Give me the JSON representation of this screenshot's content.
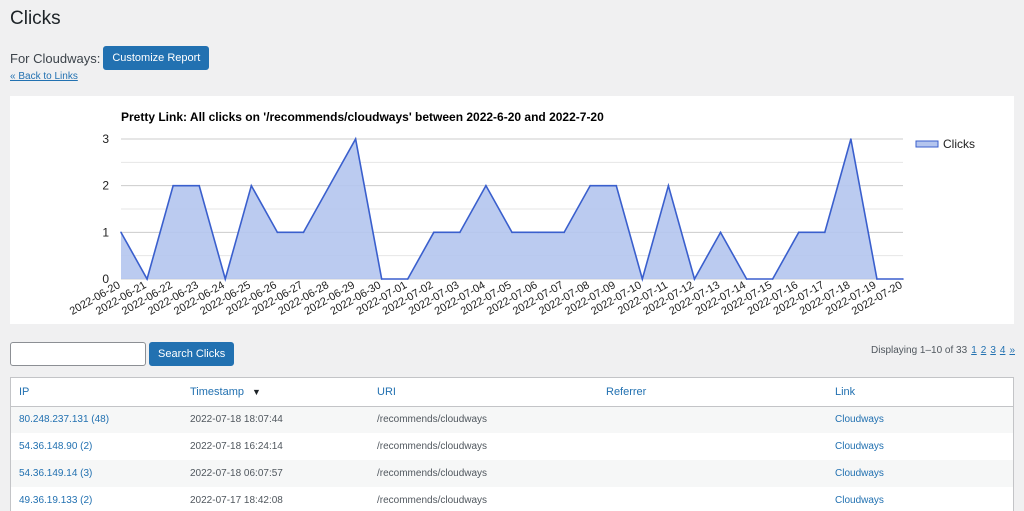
{
  "page": {
    "title": "Clicks"
  },
  "report": {
    "for_label": "For Cloudways:",
    "customize_label": "Customize Report",
    "back_label": "« Back to Links"
  },
  "search": {
    "value": "",
    "placeholder": "",
    "button_label": "Search Clicks"
  },
  "pagination": {
    "displaying": "Displaying 1–10 of 33",
    "pages": [
      "1",
      "2",
      "3",
      "4"
    ],
    "next": "»"
  },
  "table": {
    "columns": [
      "IP",
      "Timestamp",
      "URI",
      "Referrer",
      "Link"
    ],
    "sort_icon": "sort-desc-icon",
    "rows": [
      {
        "ip": "80.248.237.131 (48)",
        "timestamp": "2022-07-18 18:07:44",
        "uri": "/recommends/cloudways",
        "referrer": "",
        "link": "Cloudways"
      },
      {
        "ip": "54.36.148.90 (2)",
        "timestamp": "2022-07-18 16:24:14",
        "uri": "/recommends/cloudways",
        "referrer": "",
        "link": "Cloudways"
      },
      {
        "ip": "54.36.149.14 (3)",
        "timestamp": "2022-07-18 06:07:57",
        "uri": "/recommends/cloudways",
        "referrer": "",
        "link": "Cloudways"
      },
      {
        "ip": "49.36.19.133 (2)",
        "timestamp": "2022-07-17 18:42:08",
        "uri": "/recommends/cloudways",
        "referrer": "",
        "link": "Cloudways"
      }
    ]
  },
  "colors": {
    "accent": "#2271b1",
    "series_line": "#3a5fcd",
    "series_fill": "#b4c5ee"
  },
  "chart_data": {
    "type": "area",
    "title": "Pretty Link: All clicks on '/recommends/cloudways' between 2022-6-20 and 2022-7-20",
    "x": [
      "2022-06-20",
      "2022-06-21",
      "2022-06-22",
      "2022-06-23",
      "2022-06-24",
      "2022-06-25",
      "2022-06-26",
      "2022-06-27",
      "2022-06-28",
      "2022-06-29",
      "2022-06-30",
      "2022-07-01",
      "2022-07-02",
      "2022-07-03",
      "2022-07-04",
      "2022-07-05",
      "2022-07-06",
      "2022-07-07",
      "2022-07-08",
      "2022-07-09",
      "2022-07-10",
      "2022-07-11",
      "2022-07-12",
      "2022-07-13",
      "2022-07-14",
      "2022-07-15",
      "2022-07-16",
      "2022-07-17",
      "2022-07-18",
      "2022-07-19",
      "2022-07-20"
    ],
    "series": [
      {
        "name": "Clicks",
        "values": [
          1,
          0,
          2,
          2,
          0,
          2,
          1,
          1,
          2,
          3,
          0,
          0,
          1,
          1,
          2,
          1,
          1,
          1,
          2,
          2,
          0,
          2,
          0,
          1,
          0,
          0,
          1,
          1,
          3,
          0,
          0
        ]
      }
    ],
    "yticks": [
      "0",
      "1",
      "2",
      "3"
    ],
    "ylim": [
      0,
      3
    ],
    "grid": true,
    "legend": "right"
  }
}
